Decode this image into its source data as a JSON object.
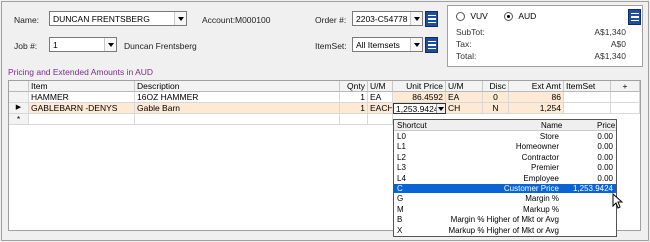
{
  "header": {
    "name_label": "Name:",
    "name_value": "DUNCAN FRENTSBERG",
    "account_label": "Account:",
    "account_value": "M000100",
    "order_label": "Order #:",
    "order_value": "2203-C54778",
    "job_label": "Job #:",
    "job_value": "1",
    "job_name": "Duncan Frentsberg",
    "itemset_label": "ItemSet:",
    "itemset_value": "All Itemsets"
  },
  "currency": {
    "opt1": "VUV",
    "opt2": "AUD",
    "selected": "AUD",
    "subtotal_label": "SubTot:",
    "subtotal_value": "A$1,340",
    "tax_label": "Tax:",
    "tax_value": "A$0",
    "total_label": "Total:",
    "total_value": "A$1,340"
  },
  "section_title": "Pricing and Extended Amounts in AUD",
  "grid": {
    "columns": [
      "Item",
      "Description",
      "Qnty",
      "U/M",
      "Unit Price",
      "U/M",
      "Disc",
      "Ext Amt",
      "ItemSet",
      "+"
    ],
    "rows": [
      {
        "item": "HAMMER",
        "description": "16OZ HAMMER",
        "qnty": "1",
        "um": "EA",
        "unit_price": "86.4592",
        "um2": "EA",
        "disc": "0",
        "ext_amt": "86",
        "itemset": ""
      },
      {
        "item": "GABLEBARN -DENYS",
        "description": "Gable Barn",
        "qnty": "1",
        "um": "EACH",
        "unit_price": "1,253.9424",
        "um2": "CH",
        "disc": "N",
        "ext_amt": "1,254",
        "itemset": ""
      }
    ],
    "new_row_marker": "*",
    "current_row_marker": "▶"
  },
  "price_dropdown": {
    "headers": {
      "shortcut": "Shortcut",
      "name": "Name",
      "price": "Price"
    },
    "options": [
      {
        "shortcut": "L0",
        "name": "Store",
        "price": "0.00"
      },
      {
        "shortcut": "L1",
        "name": "Homeowner",
        "price": "0.00"
      },
      {
        "shortcut": "L2",
        "name": "Contractor",
        "price": "0.00"
      },
      {
        "shortcut": "L3",
        "name": "Premier",
        "price": "0.00"
      },
      {
        "shortcut": "L4",
        "name": "Employee",
        "price": "0.00"
      },
      {
        "shortcut": "C",
        "name": "Customer Price",
        "price": "1,253.9424"
      },
      {
        "shortcut": "G",
        "name": "Margin %",
        "price": ""
      },
      {
        "shortcut": "M",
        "name": "Markup %",
        "price": ""
      },
      {
        "shortcut": "B",
        "name": "Margin % Higher of Mkt or Avg",
        "price": ""
      },
      {
        "shortcut": "X",
        "name": "Markup % Higher of Mkt or Avg",
        "price": ""
      }
    ],
    "selected_index": 5
  },
  "colors": {
    "accent": "#1f4e9a",
    "selection": "#0a64d6",
    "section_title": "#7b2c8c",
    "peach": "#fde9d4"
  },
  "icons": [
    "dropdown-arrow-icon",
    "list-menu-icon",
    "mouse-cursor-icon"
  ]
}
